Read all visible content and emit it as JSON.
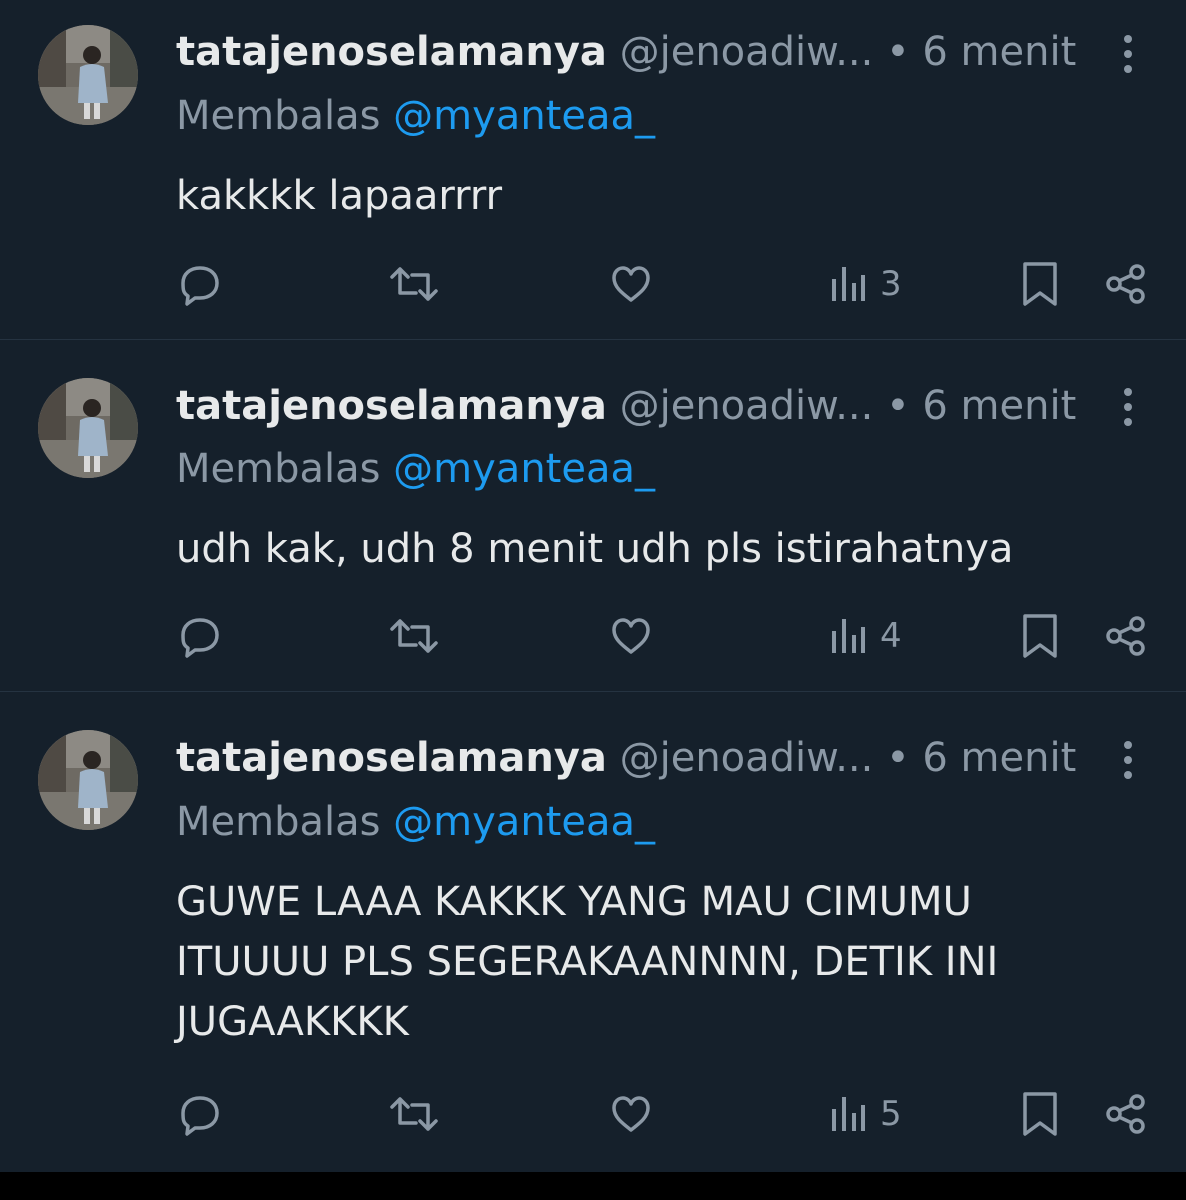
{
  "tweets": [
    {
      "display_name": "tatajenoselamanya",
      "handle": "@jenoadiw...",
      "separator": "•",
      "time": "6 menit",
      "reply_prefix": "Membalas",
      "reply_to": "@myanteaa_",
      "text_lines": [
        "kakkkk lapaarrrr"
      ],
      "views": "3"
    },
    {
      "display_name": "tatajenoselamanya",
      "handle": "@jenoadiw...",
      "separator": "•",
      "time": "6 menit",
      "reply_prefix": "Membalas",
      "reply_to": "@myanteaa_",
      "text_lines": [
        "udh kak, udh 8 menit udh pls istirahatnya"
      ],
      "views": "4"
    },
    {
      "display_name": "tatajenoselamanya",
      "handle": "@jenoadiw...",
      "separator": "•",
      "time": "6 menit",
      "reply_prefix": "Membalas",
      "reply_to": "@myanteaa_",
      "text_lines": [
        "GUWE LAAA KAKKK YANG MAU CIMUMU",
        "ITUUUU PLS SEGERAKAANNNN, DETIK INI",
        "JUGAAKKKK"
      ],
      "views": "5"
    }
  ],
  "icons": {
    "reply": "speech-bubble-icon",
    "retweet": "retweet-arrows-icon",
    "like": "heart-icon",
    "views": "bar-chart-icon",
    "bookmark": "bookmark-icon",
    "share": "share-nodes-icon",
    "more": "vertical-dots-icon"
  },
  "colors": {
    "background": "#15202B",
    "text_primary": "#E7E9EA",
    "text_secondary": "#8B98A5",
    "mention": "#1D9BF0",
    "divider": "#253341"
  }
}
